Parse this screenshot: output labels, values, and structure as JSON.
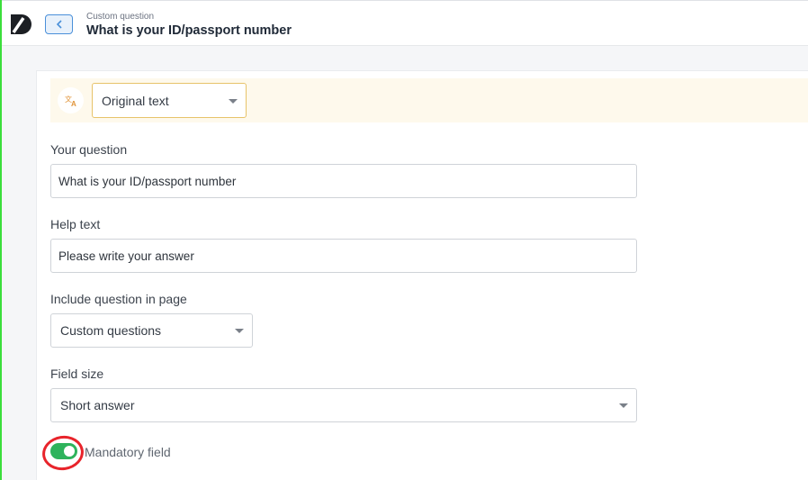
{
  "header": {
    "breadcrumb": "Custom question",
    "title": "What is your ID/passport number"
  },
  "language": {
    "icon": "translate-icon",
    "selected": "Original text"
  },
  "form": {
    "question": {
      "label": "Your question",
      "value": "What is your ID/passport number"
    },
    "help": {
      "label": "Help text",
      "value": "Please write your answer"
    },
    "page": {
      "label": "Include question in page",
      "selected": "Custom questions"
    },
    "size": {
      "label": "Field size",
      "selected": "Short answer"
    },
    "mandatory": {
      "label": "Mandatory field",
      "checked": true
    }
  },
  "colors": {
    "accent": "#4a90d9",
    "toggle_on": "#2eb35c",
    "annotation": "#e8242b",
    "lang_strip": "#fef9ec"
  }
}
